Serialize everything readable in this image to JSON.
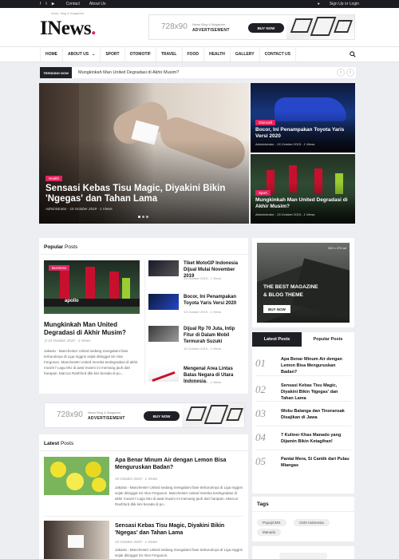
{
  "topbar": {
    "links": [
      "Contact",
      "About Us"
    ],
    "signin": "Sign Up or Login"
  },
  "brand": {
    "logo": "INews",
    "logo_dot": ".",
    "tagline": "news, blog & magazine"
  },
  "ad": {
    "size": "728x90",
    "line1": "News Blog & Magazine",
    "line2": "ADVERTISEMENT",
    "button": "BUY NOW"
  },
  "nav": {
    "items": [
      "HOME",
      "ABOUT US",
      "SPORT",
      "OTOMOTIF",
      "TRAVEL",
      "FOOD",
      "HEALTH",
      "GALLERY",
      "CONTACT US"
    ]
  },
  "trending": {
    "label": "TRENDING NOW",
    "text": "Mungkinkah Man United Degradasi di Akhir Musim?"
  },
  "hero": {
    "category": "Health",
    "title": "Sensasi Kebas Tisu Magic, Diyakini Bikin 'Ngegas' dan Tahan Lama",
    "meta": "Administrator  -  15 October 2019  -  1 Views"
  },
  "side_posts": [
    {
      "category": "Otomotif",
      "title": "Bocor, Ini Penampakan Toyota Yaris Versi 2020",
      "meta": "Administrator  -  15 October 2019  -  1 Views"
    },
    {
      "category": "Sport",
      "title": "Mungkinkah Man United Degradasi di Akhir Musim?",
      "meta": "Administrator  -  15 October 2019  -  1 Views"
    }
  ],
  "popular": {
    "title_bold": "Popular",
    "title_rest": " Posts",
    "main": {
      "category": "Business",
      "title": "Mungkinkah Man United Degradasi di Akhir Musim?",
      "meta": "15 October 2019  -  1 Views",
      "excerpt": "Jakarta - Manchester United sedang mengalami fase terburuknya di Liga Inggris sejak ditinggal Sir Alex Ferguson. Manchester United mereka terdegradasi di akhir musim? Lagu MU di awal musim ini memang jauh dari harapan. Marcus Rashford dkk kini berada di po..."
    },
    "list": [
      {
        "title": "Tiket MotoGP Indonesia Dijual Mulai November 2019",
        "meta": "15 October 2019  -  1 Views"
      },
      {
        "title": "Bocor, Ini Penampakan Toyota Yaris Versi 2020",
        "meta": "15 October 2019  -  1 Views"
      },
      {
        "title": "Dijual Rp 70 Juta, Intip Fitur di Dalam Mobil Termurah Suzuki",
        "meta": "15 October 2019  -  1 Views"
      },
      {
        "title": "Mengenal Area Lintas Batas Negara di Utara Indonesia",
        "meta": "15 October 2019  -  1 Views"
      }
    ]
  },
  "magazine_ad": {
    "size": "320 x 270 ad",
    "line1": "THE BEST MAGAZINE",
    "line2": "& BLOG THEME",
    "button": "BUY NOW"
  },
  "tabs": {
    "latest": "Latest Posts",
    "popular": "Popular Posts"
  },
  "numbered": [
    {
      "num": "01",
      "title": "Apa Benar Minum Air dengan Lemon Bisa Menguruskan Badan?"
    },
    {
      "num": "02",
      "title": "Sensasi Kebas Tisu Magic, Diyakini Bikin 'Ngegas' dan Tahan Lama"
    },
    {
      "num": "03",
      "title": "Woku Balanga dan Tinoransak Disajikan di Jawa"
    },
    {
      "num": "04",
      "title": "7 Kuliner Khas Manado yang Dijamin Bikin Ketagihan!"
    },
    {
      "num": "05",
      "title": "Pantai Mera, Si Cantik dari Pulau Miangas"
    }
  ],
  "latest": {
    "title_bold": "Latest",
    "title_rest": " Posts",
    "items": [
      {
        "title": "Apa Benar Minum Air dengan Lemon Bisa Menguruskan Badan?",
        "meta": "15 October 2019  -  1 Views",
        "excerpt": "Jakarta - Manchester United sedang mengalami fase terburuknya di Liga Inggris sejak ditinggal Sir Alex Ferguson. Manchester United mereka terdegradasi di akhir musim? Lagu MU di awal musim ini memang jauh dari harapan. Marcus Rashford dkk kini berada di po..."
      },
      {
        "title": "Sensasi Kebas Tisu Magic, Diyakini Bikin 'Ngegas' dan Tahan Lama",
        "meta": "15 October 2019  -  1 Views",
        "excerpt": "Jakarta - Manchester United sedang mengalami fase terburuknya di Liga Inggris sejak ditinggal Sir Alex Ferguson."
      }
    ]
  },
  "tags": {
    "title": "Tags",
    "items": [
      "PopojiCMS",
      "CMS Indonesia",
      "Manado"
    ]
  },
  "colors": {
    "accent": "#e0245e",
    "dark": "#1f1f26"
  }
}
